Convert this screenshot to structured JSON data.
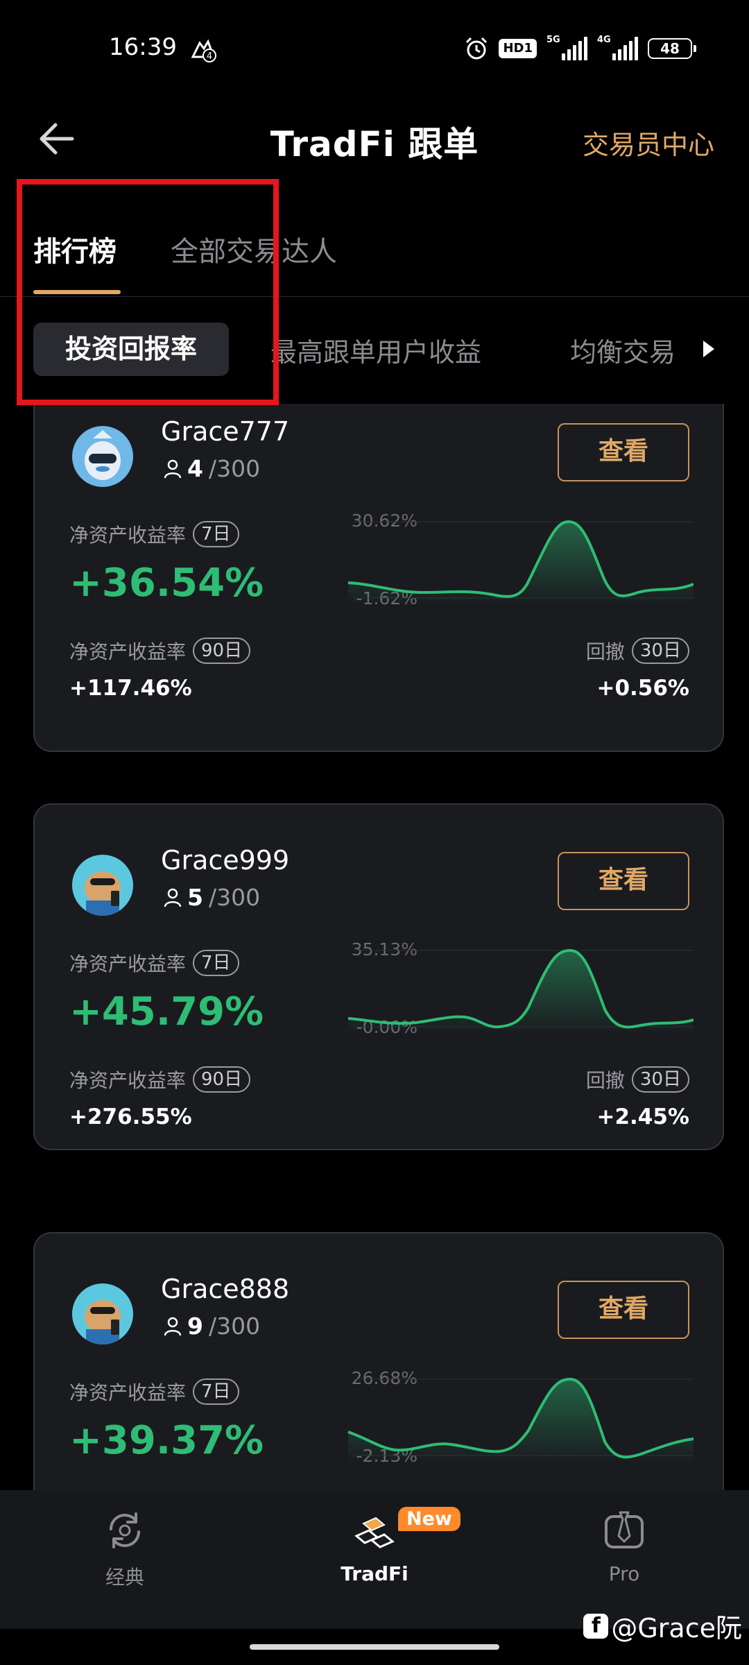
{
  "status_bar": {
    "time": "16:39",
    "hd": "HD1",
    "sig1_label": "5G",
    "sig2_label": "4G",
    "battery": "48"
  },
  "header": {
    "title": "TradFi 跟单",
    "trader_center": "交易员中心"
  },
  "tabs": {
    "rank": "排行榜",
    "all": "全部交易达人"
  },
  "sub_tabs": {
    "active": "投资回报率",
    "second": "最高跟单用户收益",
    "third": "均衡交易"
  },
  "cards": [
    {
      "name": "Grace777",
      "followers_current": "4",
      "followers_max": "/300",
      "view": "查看",
      "roi_label": "净资产收益率",
      "roi_period": "7日",
      "roi_7d": "+36.54%",
      "chart_max": "30.62%",
      "chart_min": "-1.62%",
      "roi90_label": "净资产收益率",
      "roi90_period": "90日",
      "roi_90d": "+117.46%",
      "dd_label": "回撤",
      "dd_period": "30日",
      "drawdown": "+0.56%"
    },
    {
      "name": "Grace999",
      "followers_current": "5",
      "followers_max": "/300",
      "view": "查看",
      "roi_label": "净资产收益率",
      "roi_period": "7日",
      "roi_7d": "+45.79%",
      "chart_max": "35.13%",
      "chart_min": "-0.00%",
      "roi90_label": "净资产收益率",
      "roi90_period": "90日",
      "roi_90d": "+276.55%",
      "dd_label": "回撤",
      "dd_period": "30日",
      "drawdown": "+2.45%"
    },
    {
      "name": "Grace888",
      "followers_current": "9",
      "followers_max": "/300",
      "view": "查看",
      "roi_label": "净资产收益率",
      "roi_period": "7日",
      "roi_7d": "+39.37%",
      "chart_max": "26.68%",
      "chart_min": "-2.13%"
    }
  ],
  "bottom_nav": {
    "classic": "经典",
    "tradfi": "TradFi",
    "pro": "Pro",
    "new_badge": "New"
  },
  "watermark": "@Grace阮",
  "colors": {
    "accent": "#e0a866",
    "positive": "#2ebd74",
    "highlight": "#e5161c",
    "card_bg": "#1a1b1f"
  }
}
